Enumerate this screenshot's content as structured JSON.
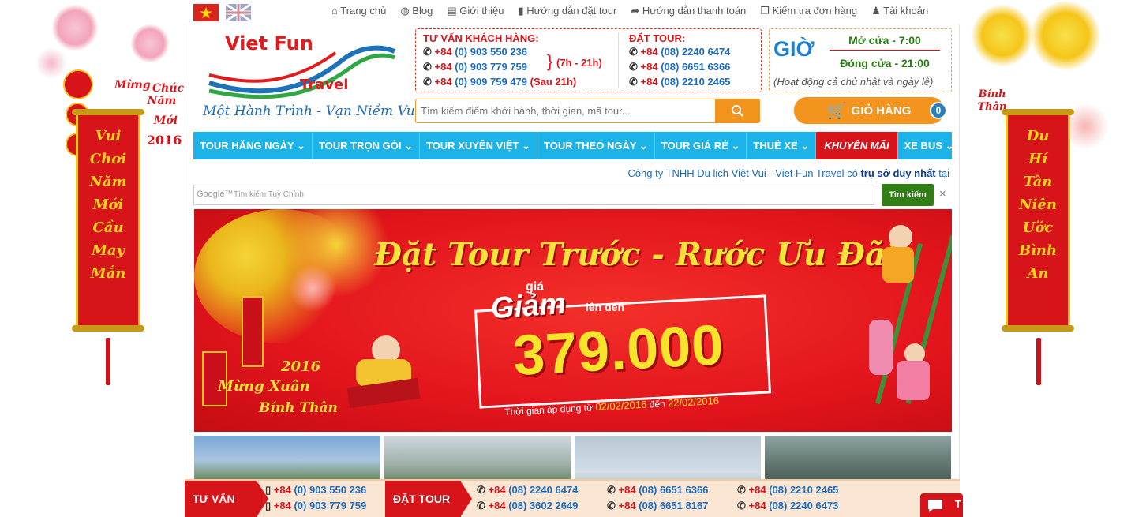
{
  "top_nav": {
    "items": [
      "Trang chủ",
      "Blog",
      "Giới thiệu",
      "Hướng dẫn đặt tour",
      "Hướng dẫn thanh toán",
      "Kiểm tra đơn hàng",
      "Tài khoản"
    ]
  },
  "side_left": {
    "greeting": [
      "Chúc",
      "Mừng",
      "Năm",
      "Mới",
      "2016"
    ],
    "banner": [
      "Vui",
      "Chơi",
      "Năm",
      "Mới",
      "Cầu",
      "May",
      "Mắn"
    ]
  },
  "side_right": {
    "greeting": "Bính Thân",
    "banner": [
      "Du",
      "Hí",
      "Tân",
      "Niên",
      "Ước",
      "Bình",
      "An"
    ]
  },
  "logo": {
    "name": "Viet Fun",
    "sub": "Travel",
    "slogan": "Một Hành Trình - Vạn Niềm Vui"
  },
  "consult": {
    "title": "TƯ VẤN KHÁCH HÀNG:",
    "lines": [
      {
        "prefix": "+84",
        "number": "(0) 903 550 236"
      },
      {
        "prefix": "+84",
        "number": "(0) 903 779 759"
      },
      {
        "prefix": "+84",
        "number": "(0) 909 759 479"
      }
    ],
    "hours_day": "(7h - 21h)",
    "hours_night": "(Sau 21h)"
  },
  "booking": {
    "title": "ĐẶT TOUR:",
    "lines": [
      {
        "prefix": "+84",
        "number": "(08) 2240 6474"
      },
      {
        "prefix": "+84",
        "number": "(08) 6651 6366"
      },
      {
        "prefix": "+84",
        "number": "(08) 2210 2465"
      }
    ]
  },
  "hours": {
    "label": "GIỜ",
    "open": "Mở cửa - 7:00",
    "close": "Đóng cửa - 21:00",
    "note": "(Hoạt động cả chủ nhật và ngày lễ)"
  },
  "search": {
    "placeholder": "Tìm kiếm điểm khởi hành, thời gian, mã tour..."
  },
  "cart": {
    "label": "GIỎ HÀNG",
    "count": "0"
  },
  "main_nav": [
    {
      "label": "TOUR HẰNG NGÀY",
      "caret": "⌄"
    },
    {
      "label": "TOUR TRỌN GÓI",
      "caret": "⌄"
    },
    {
      "label": "TOUR XUYÊN VIỆT",
      "caret": "⌄"
    },
    {
      "label": "TOUR THEO NGÀY",
      "caret": "⌄"
    },
    {
      "label": "TOUR GIÁ RẺ",
      "caret": "⌄"
    },
    {
      "label": "THUÊ XE",
      "caret": "⌄"
    },
    {
      "label": "KHUYẾN MÃI",
      "caret": ""
    },
    {
      "label": "XE BUS",
      "caret": "⌄"
    }
  ],
  "company_line": {
    "text": "Công ty TNHH Du lịch Việt Vui - Viet Fun Travel có",
    "bold": "trụ sở duy nhất",
    "tail": "tại"
  },
  "google_search": {
    "brand": "Google™",
    "placeholder": "Tìm kiếm Tuỳ Chỉnh",
    "button": "Tìm kiếm",
    "close": "×"
  },
  "hero": {
    "headline": "Đặt Tour Trước - Rước Ưu Đãi",
    "gia": "giá",
    "giam": "Giảm",
    "len_den": "lên đến",
    "amount": "379.000",
    "period_prefix": "Thời gian áp dụng từ",
    "date_from": "02/02/2016",
    "period_mid": "đến",
    "date_to": "22/02/2016",
    "year": "2016",
    "mung_xuan": "Mừng Xuân",
    "binh_than": "Bính Thân"
  },
  "bottom_bar": {
    "consult_label": "TƯ VẤN",
    "consult_numbers": [
      {
        "prefix": "+84",
        "number": "(0) 903 550 236"
      },
      {
        "prefix": "+84",
        "number": "(0) 903 779 759"
      }
    ],
    "booking_label": "ĐẶT TOUR",
    "booking_numbers": [
      {
        "prefix": "+84",
        "number": "(08) 2240 6474"
      },
      {
        "prefix": "+84",
        "number": "(08) 3602 2649"
      },
      {
        "prefix": "+84",
        "number": "(08) 6651 6366"
      },
      {
        "prefix": "+84",
        "number": "(08) 6651 8167"
      },
      {
        "prefix": "+84",
        "number": "(08) 2210 2465"
      },
      {
        "prefix": "+84",
        "number": "(08) 2240 6473"
      }
    ],
    "chat_letter": "T"
  },
  "colors": {
    "red": "#d8141b",
    "nav_blue": "#1cb3e8",
    "orange": "#f3941e",
    "gold": "#f7d21c"
  }
}
